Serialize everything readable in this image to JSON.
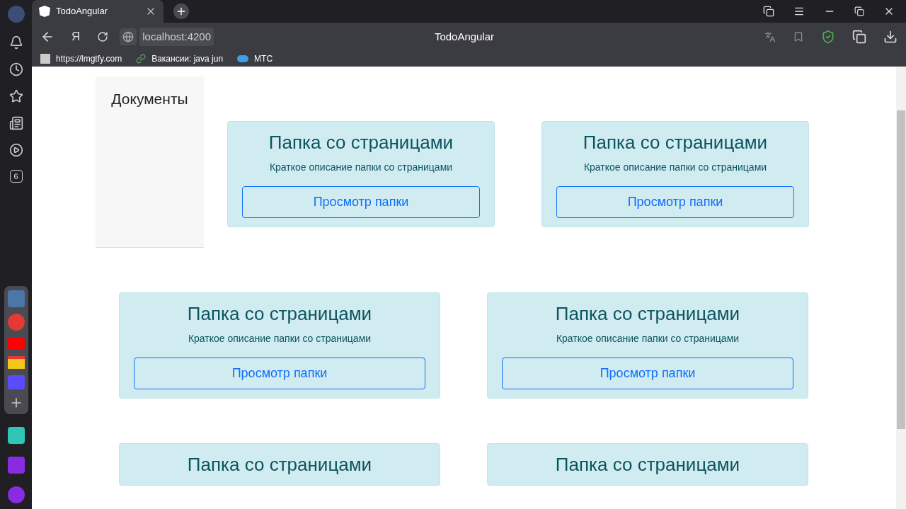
{
  "browser": {
    "tabs": [
      {
        "title": "TodoAngular",
        "selected": true
      }
    ],
    "address": "localhost:4200",
    "page_title": "TodoAngular",
    "bookmarks": [
      "https://lmgtfy.com",
      "Вакансии: java jun",
      "МТС"
    ],
    "sidebar_badge": "6",
    "yandex_button": "Я"
  },
  "documents_panel": {
    "title": "Документы"
  },
  "card_rows": [
    [
      {
        "title": "Папка со страницами",
        "description": "Краткое описание папки со страницами",
        "button": "Просмотр папки"
      },
      {
        "title": "Папка со страницами",
        "description": "Краткое описание папки со страницами",
        "button": "Просмотр папки"
      }
    ],
    [
      {
        "title": "Папка со страницами",
        "description": "Краткое описание папки со страницами",
        "button": "Просмотр папки"
      },
      {
        "title": "Папка со страницами",
        "description": "Краткое описание папки со страницами",
        "button": "Просмотр папки"
      }
    ],
    [
      {
        "title": "Папка со страницами"
      },
      {
        "title": "Папка со страницами"
      }
    ]
  ]
}
